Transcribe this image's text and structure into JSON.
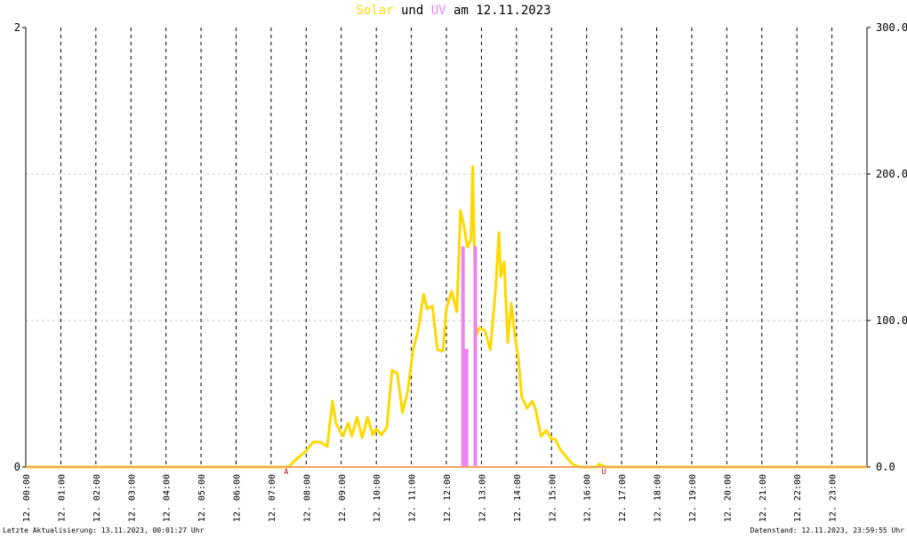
{
  "title": {
    "part1": "Solar",
    "part2": " und ",
    "part3": "UV",
    "part4": " am 12.11.2023",
    "color_solar": "#FFD800",
    "color_uv": "#EE82EE",
    "color_text": "#000000"
  },
  "footer": {
    "left": "Letzte Aktualisierung: 13.11.2023, 00:01:27 Uhr",
    "right": "Datenstand: 12.11.2023, 23:59:55 Uhr"
  },
  "chart_data": {
    "type": "line",
    "title": "Solar und UV am 12.11.2023",
    "x_unit": "hour",
    "xlim": [
      0,
      24
    ],
    "x_tick_labels": [
      "12. 00:00",
      "12. 01:00",
      "12. 02:00",
      "12. 03:00",
      "12. 04:00",
      "12. 05:00",
      "12. 06:00",
      "12. 07:00",
      "12. 08:00",
      "12. 09:00",
      "12. 10:00",
      "12. 11:00",
      "12. 12:00",
      "12. 13:00",
      "12. 14:00",
      "12. 15:00",
      "12. 16:00",
      "12. 17:00",
      "12. 18:00",
      "12. 19:00",
      "12. 20:00",
      "12. 21:00",
      "12. 22:00",
      "12. 23:00"
    ],
    "y_left": {
      "min": 0,
      "max": 3,
      "tick_labels": [
        "0",
        "2"
      ]
    },
    "y_right": {
      "min": 0,
      "max": 300,
      "tick_labels": [
        "0.0",
        "100.0",
        "200.0",
        "300.0"
      ]
    },
    "grid": true,
    "sunrise_label": "A",
    "sunrise_hour": 7.43,
    "sunset_label": "U",
    "sunset_hour": 16.49,
    "series": [
      {
        "name": "Solar",
        "axis": "right",
        "color": "#FFD800",
        "points": [
          [
            0,
            0
          ],
          [
            7.5,
            0
          ],
          [
            7.7,
            5
          ],
          [
            7.85,
            8
          ],
          [
            8.0,
            11
          ],
          [
            8.2,
            17
          ],
          [
            8.4,
            17
          ],
          [
            8.6,
            14
          ],
          [
            8.75,
            45
          ],
          [
            8.85,
            30
          ],
          [
            8.95,
            25
          ],
          [
            9.05,
            21
          ],
          [
            9.2,
            30
          ],
          [
            9.3,
            21
          ],
          [
            9.45,
            34
          ],
          [
            9.6,
            20
          ],
          [
            9.75,
            34
          ],
          [
            9.9,
            22
          ],
          [
            10.0,
            26
          ],
          [
            10.15,
            22
          ],
          [
            10.3,
            27
          ],
          [
            10.45,
            66
          ],
          [
            10.6,
            64
          ],
          [
            10.75,
            37
          ],
          [
            10.9,
            52
          ],
          [
            11.05,
            80
          ],
          [
            11.2,
            94
          ],
          [
            11.35,
            118
          ],
          [
            11.45,
            108
          ],
          [
            11.6,
            110
          ],
          [
            11.75,
            80
          ],
          [
            11.9,
            79
          ],
          [
            12.0,
            108
          ],
          [
            12.15,
            120
          ],
          [
            12.3,
            106
          ],
          [
            12.4,
            175
          ],
          [
            12.5,
            165
          ],
          [
            12.6,
            150
          ],
          [
            12.7,
            155
          ],
          [
            12.75,
            205
          ],
          [
            12.85,
            90
          ],
          [
            12.95,
            95
          ],
          [
            13.1,
            93
          ],
          [
            13.25,
            80
          ],
          [
            13.4,
            120
          ],
          [
            13.5,
            160
          ],
          [
            13.55,
            130
          ],
          [
            13.65,
            140
          ],
          [
            13.75,
            85
          ],
          [
            13.85,
            112
          ],
          [
            13.95,
            90
          ],
          [
            14.05,
            75
          ],
          [
            14.15,
            48
          ],
          [
            14.3,
            40
          ],
          [
            14.45,
            45
          ],
          [
            14.55,
            39
          ],
          [
            14.7,
            21
          ],
          [
            14.85,
            25
          ],
          [
            15.0,
            19
          ],
          [
            15.1,
            19
          ],
          [
            15.25,
            12
          ],
          [
            15.45,
            6
          ],
          [
            15.6,
            2
          ],
          [
            15.8,
            0
          ],
          [
            16.3,
            0
          ],
          [
            16.35,
            2
          ],
          [
            16.45,
            1
          ],
          [
            16.55,
            0
          ],
          [
            24,
            0
          ]
        ]
      },
      {
        "name": "UV",
        "axis": "left",
        "color": "#EE82EE",
        "points": [
          [
            0,
            0
          ],
          [
            12.45,
            0
          ],
          [
            12.45,
            1.5
          ],
          [
            12.5,
            1.5
          ],
          [
            12.5,
            0
          ],
          [
            12.55,
            0
          ],
          [
            12.55,
            0.8
          ],
          [
            12.6,
            0.8
          ],
          [
            12.6,
            0
          ],
          [
            12.8,
            0
          ],
          [
            12.8,
            1.5
          ],
          [
            12.85,
            1.5
          ],
          [
            12.85,
            0
          ],
          [
            24,
            0
          ]
        ]
      }
    ]
  }
}
